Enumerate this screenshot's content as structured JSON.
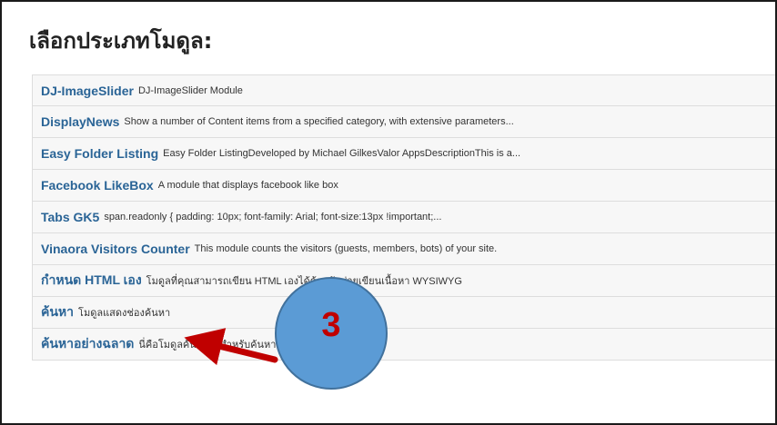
{
  "page": {
    "heading": "เลือกประเภทโมดูล:"
  },
  "modules": [
    {
      "name": "DJ-ImageSlider",
      "description": "DJ-ImageSlider Module"
    },
    {
      "name": "DisplayNews",
      "description": "Show a number of Content items from a specified category, with extensive parameters..."
    },
    {
      "name": "Easy Folder Listing",
      "description": "Easy Folder ListingDeveloped by Michael GilkesValor AppsDescriptionThis is a..."
    },
    {
      "name": "Facebook LikeBox",
      "description": "A module that displays facebook like box"
    },
    {
      "name": "Tabs GK5",
      "description": "span.readonly { padding: 10px; font-family: Arial; font-size:13px !important;..."
    },
    {
      "name": "Vinaora Visitors Counter",
      "description": "This module counts the visitors (guests, members, bots) of your site."
    },
    {
      "name": "กำหนด HTML เอง",
      "description": "โมดูลที่คุณสามารถเขียน HTML เองได้ด้วยตัวช่วยเขียนเนื้อหา WYSIWYG"
    },
    {
      "name": "ค้นหา",
      "description": "โมดูลแสดงช่องค้นหา"
    },
    {
      "name": "ค้นหาอย่างฉลาด",
      "description": "นี่คือโมดูลค้นหาใช้สำหรับค้นหาข้อมูลในระบบอย่างฉลาด"
    }
  ],
  "annotation": {
    "step_number": "3",
    "circle_color": "#5b9bd5",
    "arrow_color": "#c00000"
  },
  "colors": {
    "link": "#2a6496",
    "row_background": "#f7f7f7",
    "row_border": "#dddddd"
  }
}
